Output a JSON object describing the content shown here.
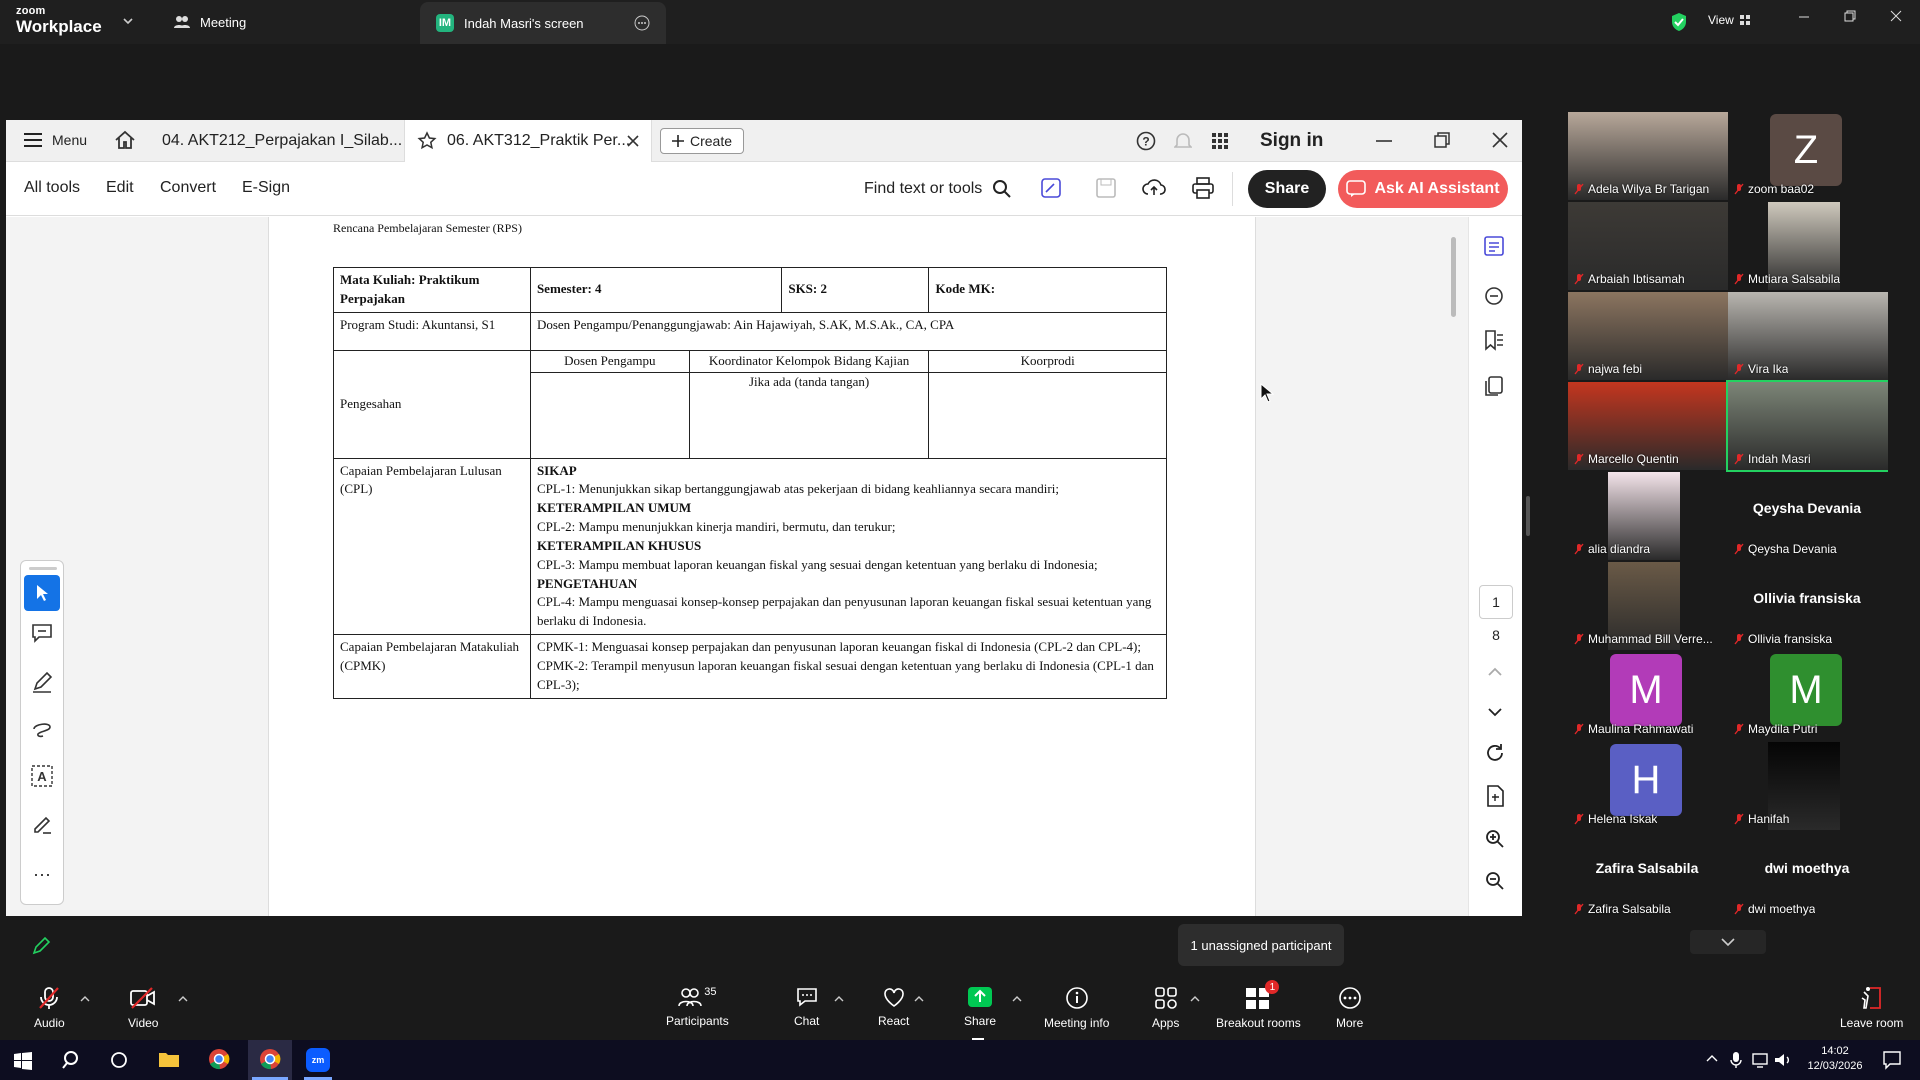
{
  "zoom": {
    "logo_top": "zoom",
    "logo_bottom": "Workplace",
    "tab_meeting": "Meeting",
    "tab_screen": "Indah Masri's screen",
    "tab_screen_badge": "IM",
    "view_label": "View"
  },
  "acrobat": {
    "menu_label": "Menu",
    "tabs": [
      "04. AKT212_Perpajakan I_Silab...",
      "06. AKT312_Praktik Per..."
    ],
    "create_label": "Create",
    "sign_in": "Sign in",
    "toolbar": [
      "All tools",
      "Edit",
      "Convert",
      "E-Sign"
    ],
    "find_label": "Find text or tools",
    "share_label": "Share",
    "ai_label": "Ask AI Assistant",
    "page_current": "1",
    "page_total": "8"
  },
  "document": {
    "header": "Rencana Pembelajaran Semester (RPS)",
    "mk_title": "Mata Kuliah: Praktikum Perpajakan",
    "semester": "Semester: 4",
    "sks": "SKS: 2",
    "kode": "Kode MK:",
    "prodi": "Program Studi: Akuntansi, S1",
    "dosen": "Dosen Pengampu/Penanggungjawab: Ain Hajawiyah, S.AK, M.S.Ak., CA, CPA",
    "pengesahan": "Pengesahan",
    "col_dosen": "Dosen Pengampu",
    "col_koord": "Koordinator Kelompok Bidang Kajian",
    "col_koorprodi": "Koorprodi",
    "jika_ada": "Jika ada (tanda tangan)",
    "cpl_label": "Capaian Pembelajaran Lulusan (CPL)",
    "sikap": "SIKAP",
    "cpl1": "CPL-1: Menunjukkan sikap bertanggungjawab atas pekerjaan di bidang keahliannya secara mandiri;",
    "ket_umum": "KETERAMPILAN UMUM",
    "cpl2": "CPL-2: Mampu menunjukkan kinerja mandiri, bermutu, dan terukur;",
    "ket_khusus": "KETERAMPILAN KHUSUS",
    "cpl3": "CPL-3: Mampu membuat laporan keuangan fiskal yang sesuai dengan ketentuan yang berlaku di Indonesia;",
    "pengetahuan": "PENGETAHUAN",
    "cpl4": "CPL-4: Mampu menguasai konsep-konsep perpajakan dan penyusunan laporan keuangan fiskal sesuai ketentuan yang berlaku di Indonesia.",
    "cpmk_label": "Capaian Pembelajaran Matakuliah (CPMK)",
    "cpmk1": "CPMK-1: Menguasai konsep perpajakan dan penyusunan laporan keuangan fiskal di Indonesia (CPL-2 dan CPL-4);",
    "cpmk2": "CPMK-2: Terampil menyusun laporan keuangan fiskal sesuai dengan ketentuan yang berlaku di Indonesia (CPL-1 dan CPL-3);"
  },
  "participants": [
    {
      "name": "Adela Wilya Br Tarigan",
      "type": "video",
      "color": "#b8a89a"
    },
    {
      "name": "zoom baa02",
      "type": "letter",
      "letter": "Z",
      "color": "#5a4a44"
    },
    {
      "name": "Arbaiah Ibtisamah",
      "type": "video",
      "color": "#3d3a36"
    },
    {
      "name": "Mutiara Salsabila",
      "type": "video",
      "color": "#cfc9bd"
    },
    {
      "name": "najwa febi",
      "type": "video",
      "color": "#8c7560"
    },
    {
      "name": "Vira Ika",
      "type": "video",
      "color": "#b9b6b0"
    },
    {
      "name": "Marcello Quentin",
      "type": "video",
      "color": "#c4361f"
    },
    {
      "name": "Indah Masri",
      "type": "video",
      "color": "#7c8577"
    },
    {
      "name": "alia diandra",
      "type": "video",
      "color": "#f4e4ea"
    },
    {
      "name": "Qeysha Devania",
      "type": "name",
      "title": "Qeysha Devania"
    },
    {
      "name": "Muhammad Bill Verre...",
      "type": "video",
      "color": "#6a5a47"
    },
    {
      "name": "Ollivia fransiska",
      "type": "name",
      "title": "Ollivia fransiska"
    },
    {
      "name": "Maulina Rahmawati",
      "type": "letter",
      "letter": "M",
      "color": "#b23bb8"
    },
    {
      "name": "Maydila Putri",
      "type": "letter",
      "letter": "M",
      "color": "#2f8f2f"
    },
    {
      "name": "Helena Iskak",
      "type": "letter",
      "letter": "H",
      "color": "#5a5fc4"
    },
    {
      "name": "Hanifah",
      "type": "video",
      "color": "#050505"
    },
    {
      "name": "Zafira Salsabila",
      "type": "name",
      "title": "Zafira Salsabila"
    },
    {
      "name": "dwi moethya",
      "type": "name",
      "title": "dwi moethya"
    }
  ],
  "unassigned_toast": "1 unassigned participant",
  "meetbar": {
    "audio": "Audio",
    "video": "Video",
    "participants": "Participants",
    "participants_count": "35",
    "chat": "Chat",
    "react": "React",
    "share": "Share",
    "meeting_info": "Meeting info",
    "apps": "Apps",
    "breakout": "Breakout rooms",
    "breakout_badge": "1",
    "more": "More",
    "leave": "Leave room"
  },
  "taskbar": {
    "time": "14:02",
    "date": "12/03/2026"
  },
  "colors": {
    "zoom_green": "#00c853",
    "ai_button": "#f25b5b",
    "active_speaker": "#23d160"
  }
}
